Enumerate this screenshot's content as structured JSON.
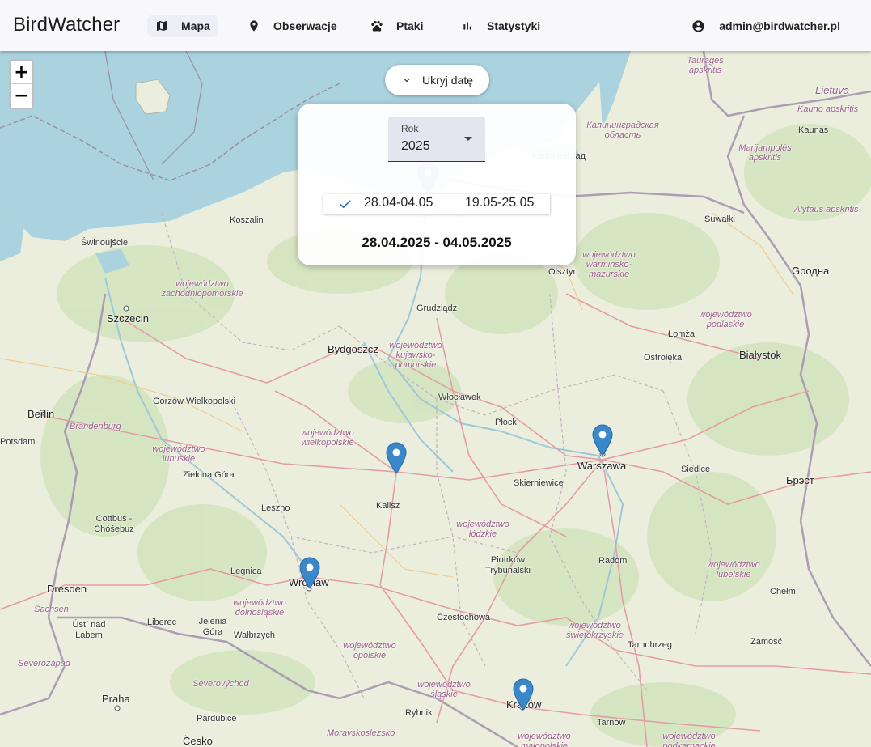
{
  "app": {
    "title": "BirdWatcher"
  },
  "nav": {
    "items": [
      {
        "label": "Mapa",
        "icon": "map-icon",
        "active": true
      },
      {
        "label": "Obserwacje",
        "icon": "location-pin-icon",
        "active": false
      },
      {
        "label": "Ptaki",
        "icon": "paw-icon",
        "active": false
      },
      {
        "label": "Statystyki",
        "icon": "bar-chart-icon",
        "active": false
      }
    ],
    "user": {
      "email": "admin@birdwatcher.pl",
      "icon": "account-circle-icon"
    }
  },
  "map": {
    "zoom_in": "+",
    "zoom_out": "−",
    "cities": [
      "Szczecin",
      "Bydgoszcz",
      "Warszawa",
      "Wrocław",
      "Kraków",
      "Białystok",
      "Berlin",
      "Dresden",
      "Praha",
      "Olsztyn",
      "Koszalin",
      "Świnoujście",
      "Gorzów Wielkopolski",
      "Zielona Góra",
      "Kalisz",
      "Płock",
      "Włocławek",
      "Grudziądz",
      "Łomża",
      "Ostrołęka",
      "Siedlce",
      "Radom",
      "Chełm",
      "Zamość",
      "Tarnów",
      "Tarnobrzeg",
      "Częstochowa",
      "Piotrków Trybunalski",
      "Skierniewice",
      "Leszno",
      "Legnica",
      "Jelenia Góra",
      "Wałbrzych",
      "Liberec",
      "Ústí nad Labem",
      "Cottbus - Chóśebuz",
      "Potsdam",
      "Suwałki",
      "Kaunas",
      "Gродна",
      "Брэст",
      "Rybnik",
      "Pardubice",
      "Калининград"
    ],
    "regions": [
      "województwo zachodniopomorskie",
      "województwo kujawsko-pomorskie",
      "województwo warmińsko-mazurskie",
      "województwo podlaskie",
      "województwo wielkopolskie",
      "województwo lubuskie",
      "województwo łódzkie",
      "województwo lubelskie",
      "województwo dolnośląskie",
      "województwo opolskie",
      "województwo śląskie",
      "województwo świętokrzyskie",
      "województwo małopolskie",
      "województwo podkarpackie",
      "Brandenburg",
      "Sachsen",
      "Lietuva",
      "Tauragės apskritis",
      "Kauno apskritis",
      "Marijampolės apskritis",
      "Alytaus apskritis",
      "Калининградская область",
      "Severozápad",
      "Severovýchod",
      "Moravskoslezsko",
      "Česko"
    ]
  },
  "date_panel": {
    "toggle_label": "Ukryj datę",
    "toggle_icon": "chevron-down-icon",
    "year_label": "Rok",
    "year_value": "2025",
    "weeks": [
      {
        "label": "28.04-04.05",
        "selected": true
      },
      {
        "label": "19.05-25.05",
        "selected": false
      }
    ],
    "selected_range": "28.04.2025 - 04.05.2025"
  },
  "colors": {
    "accent": "#1f6fb5",
    "marker": "#3a87c9",
    "water": "#aad3df",
    "land": "#e8ecd8"
  }
}
